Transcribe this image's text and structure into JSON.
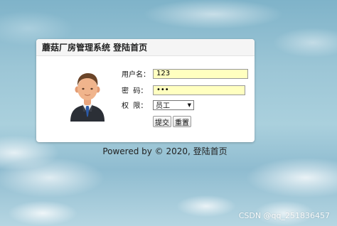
{
  "panel": {
    "title": "蘑菇厂房管理系统 登陆首页"
  },
  "form": {
    "username_label": "用户名：",
    "username_value": "123",
    "password_label": "密  码：",
    "password_value": "•••",
    "role_label": "权  限：",
    "role_selected": "员工",
    "submit_label": "提交",
    "reset_label": "重置"
  },
  "icons": {
    "avatar": "businessman-avatar-icon",
    "select_caret": "caret-down-icon"
  },
  "footer": {
    "text": "Powered by © 2020, 登陆首页"
  },
  "watermark": {
    "text": "CSDN @qq_251836457"
  },
  "colors": {
    "input_bg": "#ffffc0",
    "panel_bg": "#ffffff",
    "sky": "#9cc6d6"
  }
}
